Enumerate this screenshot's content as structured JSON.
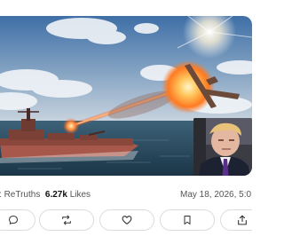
{
  "post": {
    "media": {
      "main_image": "warship-firing-laser-at-drone",
      "inset_image": "man-in-suit-reacting"
    },
    "stats": {
      "retruths_label": "ReTruths",
      "likes_count": "6.27k",
      "likes_label": "Likes",
      "date": "May 18, 2026, 5:0"
    },
    "actions": {
      "reply_icon": "comment-bubble-icon",
      "retruth_icon": "retruth-arrows-icon",
      "like_icon": "heart-icon",
      "bookmark_icon": "bookmark-icon",
      "share_icon": "share-upload-icon"
    },
    "colors": {
      "laser": "#ff6a2a",
      "explosion": "#ffb347",
      "sky": "#4d78a8",
      "sea": "#2b4d63"
    }
  }
}
